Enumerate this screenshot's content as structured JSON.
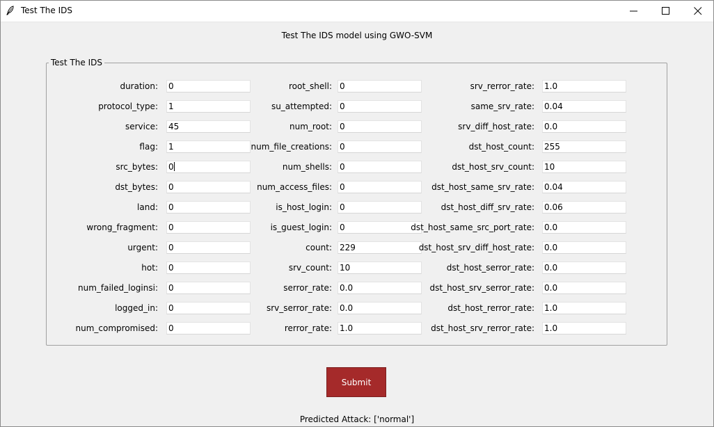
{
  "window": {
    "title": "Test The IDS"
  },
  "heading": "Test The IDS model using GWO-SVM",
  "group": {
    "legend": "Test The IDS"
  },
  "columns": [
    [
      {
        "label": "duration:",
        "value": "0"
      },
      {
        "label": "protocol_type:",
        "value": "1"
      },
      {
        "label": "service:",
        "value": "45"
      },
      {
        "label": "flag:",
        "value": "1"
      },
      {
        "label": "src_bytes:",
        "value": "0"
      },
      {
        "label": "dst_bytes:",
        "value": "0"
      },
      {
        "label": "land:",
        "value": "0"
      },
      {
        "label": "wrong_fragment:",
        "value": "0"
      },
      {
        "label": "urgent:",
        "value": "0"
      },
      {
        "label": "hot:",
        "value": "0"
      },
      {
        "label": "num_failed_loginsi:",
        "value": "0"
      },
      {
        "label": "logged_in:",
        "value": "0"
      },
      {
        "label": "num_compromised:",
        "value": "0"
      }
    ],
    [
      {
        "label": "root_shell:",
        "value": "0"
      },
      {
        "label": "su_attempted:",
        "value": "0"
      },
      {
        "label": "num_root:",
        "value": "0"
      },
      {
        "label": "num_file_creations:",
        "value": "0"
      },
      {
        "label": "num_shells:",
        "value": "0"
      },
      {
        "label": "num_access_files:",
        "value": "0"
      },
      {
        "label": "is_host_login:",
        "value": "0"
      },
      {
        "label": "is_guest_login:",
        "value": "0"
      },
      {
        "label": "count:",
        "value": "229"
      },
      {
        "label": "srv_count:",
        "value": "10"
      },
      {
        "label": "serror_rate:",
        "value": "0.0"
      },
      {
        "label": "srv_serror_rate:",
        "value": "0.0"
      },
      {
        "label": "rerror_rate:",
        "value": "1.0"
      }
    ],
    [
      {
        "label": "srv_rerror_rate:",
        "value": "1.0"
      },
      {
        "label": "same_srv_rate:",
        "value": "0.04"
      },
      {
        "label": "srv_diff_host_rate:",
        "value": "0.0"
      },
      {
        "label": "dst_host_count:",
        "value": "255"
      },
      {
        "label": "dst_host_srv_count:",
        "value": "10"
      },
      {
        "label": "dst_host_same_srv_rate:",
        "value": "0.04"
      },
      {
        "label": "dst_host_diff_srv_rate:",
        "value": "0.06"
      },
      {
        "label": "dst_host_same_src_port_rate:",
        "value": "0.0"
      },
      {
        "label": "dst_host_srv_diff_host_rate:",
        "value": "0.0"
      },
      {
        "label": "dst_host_serror_rate:",
        "value": "0.0"
      },
      {
        "label": "dst_host_srv_serror_rate:",
        "value": "0.0"
      },
      {
        "label": "dst_host_rerror_rate:",
        "value": "1.0"
      },
      {
        "label": "dst_host_srv_rerror_rate:",
        "value": "1.0"
      }
    ]
  ],
  "submit_label": "Submit",
  "result_text": "Predicted Attack: ['normal']",
  "colors": {
    "submit_bg": "#a52a2a",
    "window_bg": "#f0f0f0"
  }
}
